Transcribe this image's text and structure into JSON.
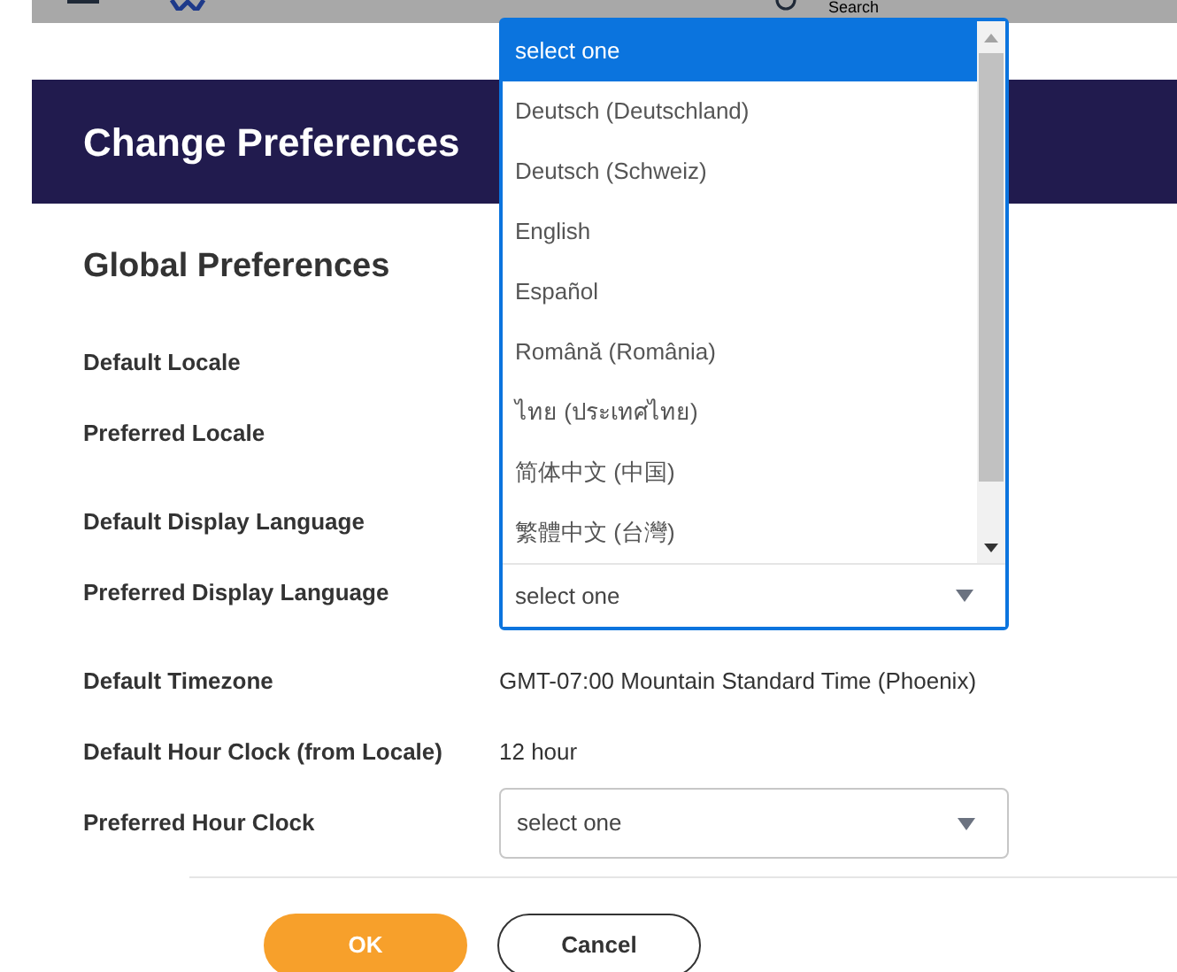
{
  "top_bar": {
    "search_placeholder": "Search"
  },
  "header": {
    "title": "Change Preferences"
  },
  "section_title": "Global Preferences",
  "field_groups": [
    [
      {
        "label": "Default Locale",
        "kind": "covered"
      },
      {
        "label": "Preferred Locale",
        "kind": "covered"
      }
    ],
    [
      {
        "label": "Default Display Language",
        "kind": "covered"
      },
      {
        "label": "Preferred Display Language",
        "kind": "select",
        "value": "select one",
        "expanded": true,
        "options": [
          {
            "label": "select one",
            "selected": true
          },
          {
            "label": "Deutsch (Deutschland)",
            "selected": false
          },
          {
            "label": "Deutsch (Schweiz)",
            "selected": false
          },
          {
            "label": "English",
            "selected": false
          },
          {
            "label": "Español",
            "selected": false
          },
          {
            "label": "Română (România)",
            "selected": false
          },
          {
            "label": "ไทย (ประเทศไทย)",
            "selected": false
          },
          {
            "label": "简体中文 (中国)",
            "selected": false
          },
          {
            "label": "繁體中文 (台灣)",
            "selected": false
          }
        ]
      }
    ],
    [
      {
        "label": "Default Timezone",
        "kind": "text",
        "value": "GMT-07:00 Mountain Standard Time (Phoenix)"
      },
      {
        "label": "Default Hour Clock (from Locale)",
        "kind": "text",
        "value": "12 hour"
      },
      {
        "label": "Preferred Hour Clock",
        "kind": "select",
        "value": "select one",
        "expanded": false
      }
    ]
  ],
  "buttons": [
    {
      "label": "OK",
      "kind": "primary"
    },
    {
      "label": "Cancel",
      "kind": "secondary"
    }
  ]
}
